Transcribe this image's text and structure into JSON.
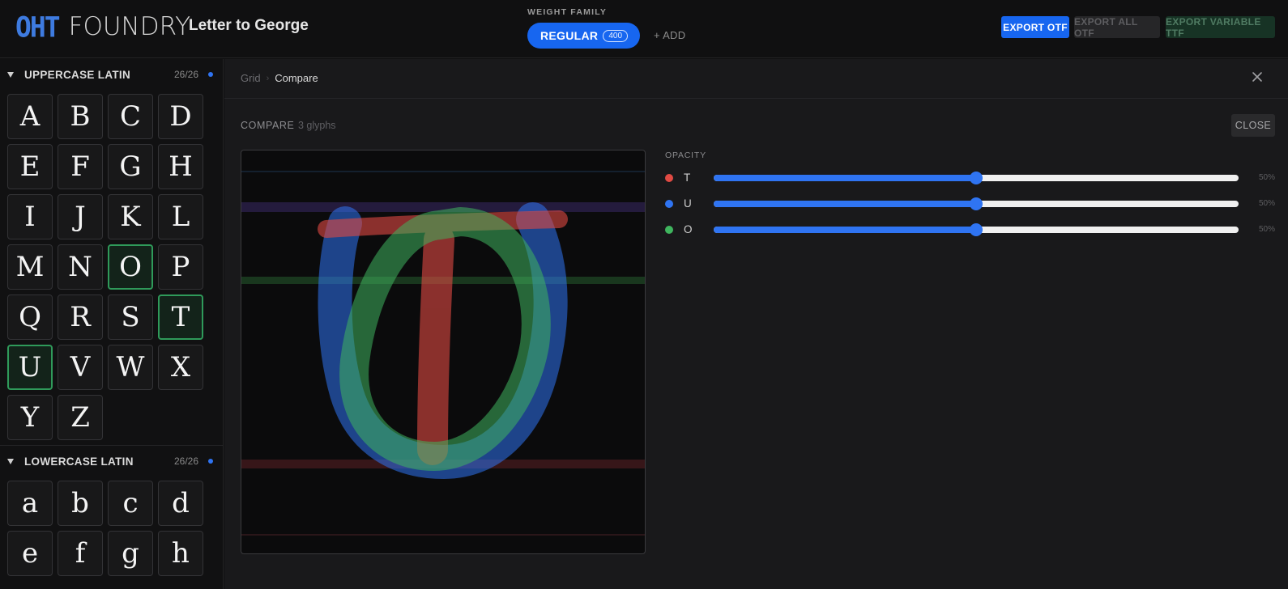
{
  "header": {
    "logo_primary": "OHT",
    "logo_secondary": "FOUNDRY",
    "document_title": "Letter to George",
    "weight_family_label": "WEIGHT FAMILY",
    "weight_name": "REGULAR",
    "weight_value": "400",
    "add_label": "+ ADD",
    "export_otf": "EXPORT OTF",
    "export_all_otf": "EXPORT ALL OTF",
    "export_variable_ttf": "EXPORT VARIABLE TTF",
    "colors": {
      "accent": "#1766f0",
      "variable_bg": "#173325"
    }
  },
  "sidebar": {
    "uppercase": {
      "title": "UPPERCASE LATIN",
      "count": "26/26",
      "glyphs": [
        "A",
        "B",
        "C",
        "D",
        "E",
        "F",
        "G",
        "H",
        "I",
        "J",
        "K",
        "L",
        "M",
        "N",
        "O",
        "P",
        "Q",
        "R",
        "S",
        "T",
        "U",
        "V",
        "W",
        "X",
        "Y",
        "Z"
      ],
      "selected": [
        "O",
        "T",
        "U"
      ]
    },
    "lowercase": {
      "title": "LOWERCASE LATIN",
      "count": "26/26",
      "glyphs": [
        "a",
        "b",
        "c",
        "d",
        "e",
        "f",
        "g",
        "h"
      ]
    }
  },
  "main": {
    "breadcrumb": {
      "parent": "Grid",
      "current": "Compare"
    },
    "compare_title": "COMPARE",
    "compare_count": "3 glyphs",
    "close_label": "CLOSE",
    "opacity_label": "OPACITY",
    "layers": [
      {
        "letter": "T",
        "color": "#e04a43",
        "opacity_percent": 50,
        "opacity_text": "50%"
      },
      {
        "letter": "U",
        "color": "#2f74f2",
        "opacity_percent": 50,
        "opacity_text": "50%"
      },
      {
        "letter": "O",
        "color": "#3fb55e",
        "opacity_percent": 50,
        "opacity_text": "50%"
      }
    ]
  }
}
